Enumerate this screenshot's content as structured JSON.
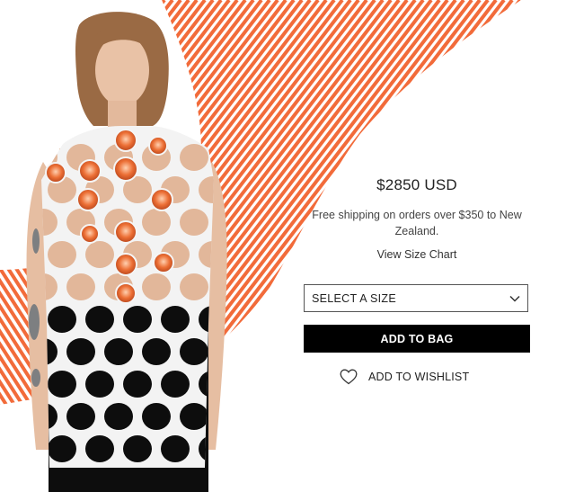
{
  "colors": {
    "stripe": "#f26b3a",
    "button_bg": "#000000",
    "button_text": "#ffffff"
  },
  "product": {
    "price": "$2850 USD",
    "shipping_note": "Free shipping on orders over $350 to New Zealand.",
    "size_chart_link": "View Size Chart",
    "size_select": {
      "selected": "SELECT A SIZE"
    },
    "add_to_bag_label": "ADD TO BAG",
    "wishlist_label": "ADD TO WISHLIST"
  },
  "icons": {
    "dropdown": "chevron-down-icon",
    "wishlist": "heart-outline-icon"
  }
}
